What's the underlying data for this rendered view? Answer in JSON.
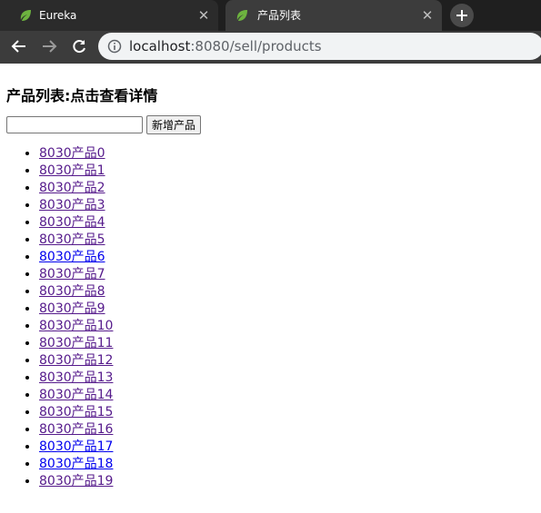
{
  "browser": {
    "tabs": [
      {
        "title": "Eureka",
        "icon": "spring-leaf-icon",
        "active": false
      },
      {
        "title": "产品列表",
        "icon": "spring-leaf-icon",
        "active": true
      }
    ],
    "address_host": "localhost",
    "address_rest": ":8080/sell/products"
  },
  "page": {
    "heading": "产品列表:点击查看详情",
    "new_input_value": "",
    "new_button_label": "新增产品",
    "products": [
      {
        "label": "8030产品0",
        "visited": true
      },
      {
        "label": "8030产品1",
        "visited": true
      },
      {
        "label": "8030产品2",
        "visited": true
      },
      {
        "label": "8030产品3",
        "visited": true
      },
      {
        "label": "8030产品4",
        "visited": true
      },
      {
        "label": "8030产品5",
        "visited": true
      },
      {
        "label": "8030产品6",
        "visited": false
      },
      {
        "label": "8030产品7",
        "visited": true
      },
      {
        "label": "8030产品8",
        "visited": true
      },
      {
        "label": "8030产品9",
        "visited": true
      },
      {
        "label": "8030产品10",
        "visited": true
      },
      {
        "label": "8030产品11",
        "visited": true
      },
      {
        "label": "8030产品12",
        "visited": true
      },
      {
        "label": "8030产品13",
        "visited": true
      },
      {
        "label": "8030产品14",
        "visited": true
      },
      {
        "label": "8030产品15",
        "visited": true
      },
      {
        "label": "8030产品16",
        "visited": true
      },
      {
        "label": "8030产品17",
        "visited": false
      },
      {
        "label": "8030产品18",
        "visited": false
      },
      {
        "label": "8030产品19",
        "visited": true
      }
    ]
  },
  "colors": {
    "visited_link": "#551a8b",
    "unvisited_link": "#0000ee",
    "spring_green": "#6db33f"
  }
}
